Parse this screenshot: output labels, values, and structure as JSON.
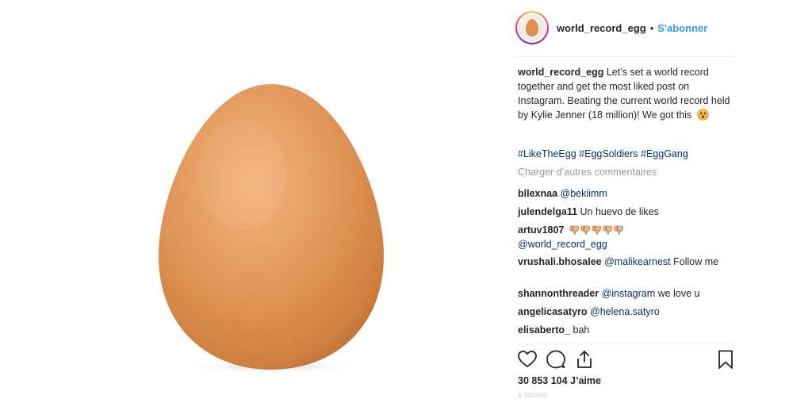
{
  "post": {
    "username": "world_record_egg",
    "separator": "•",
    "follow_label": "S'abonner",
    "caption_user": "world_record_egg",
    "caption_text": "Let’s set a world record together and get the most liked post on Instagram. Beating the current world record held by Kylie Jenner (18 million)! We got this",
    "hashtags": [
      "#LikeTheEgg",
      "#EggSoldiers",
      "#EggGang"
    ],
    "load_more": "Charger d’autres commentaires",
    "likes": "30 853 104 J’aime",
    "timestamp": "4 JOURS"
  },
  "comments": [
    {
      "user": "bllexnaa",
      "mention": "@bekiimm",
      "text": ""
    },
    {
      "user": "julendelga11",
      "mention": "",
      "text": "Un huevo de likes"
    },
    {
      "user": "artuv1807",
      "mention": "@world_record_egg",
      "text": "",
      "emoji": "thumbs-down-x5"
    },
    {
      "user": "vrushali.bhosalee",
      "mention": "@malikearnest",
      "text": "Follow me"
    },
    {
      "user": "shannonthreader",
      "mention": "@instagram",
      "text": "we love u"
    },
    {
      "user": "angelicasatyro",
      "mention": "@helena.satyro",
      "text": ""
    },
    {
      "user": "elisaberto_",
      "mention": "",
      "text": "bah"
    }
  ],
  "icons": {
    "like": "heart-icon",
    "comment": "comment-icon",
    "share": "share-icon",
    "save": "bookmark-icon"
  },
  "colors": {
    "link_blue": "#3897f0",
    "hashtag_blue": "#003569",
    "muted_gray": "#999999",
    "egg": "#e0965a"
  }
}
